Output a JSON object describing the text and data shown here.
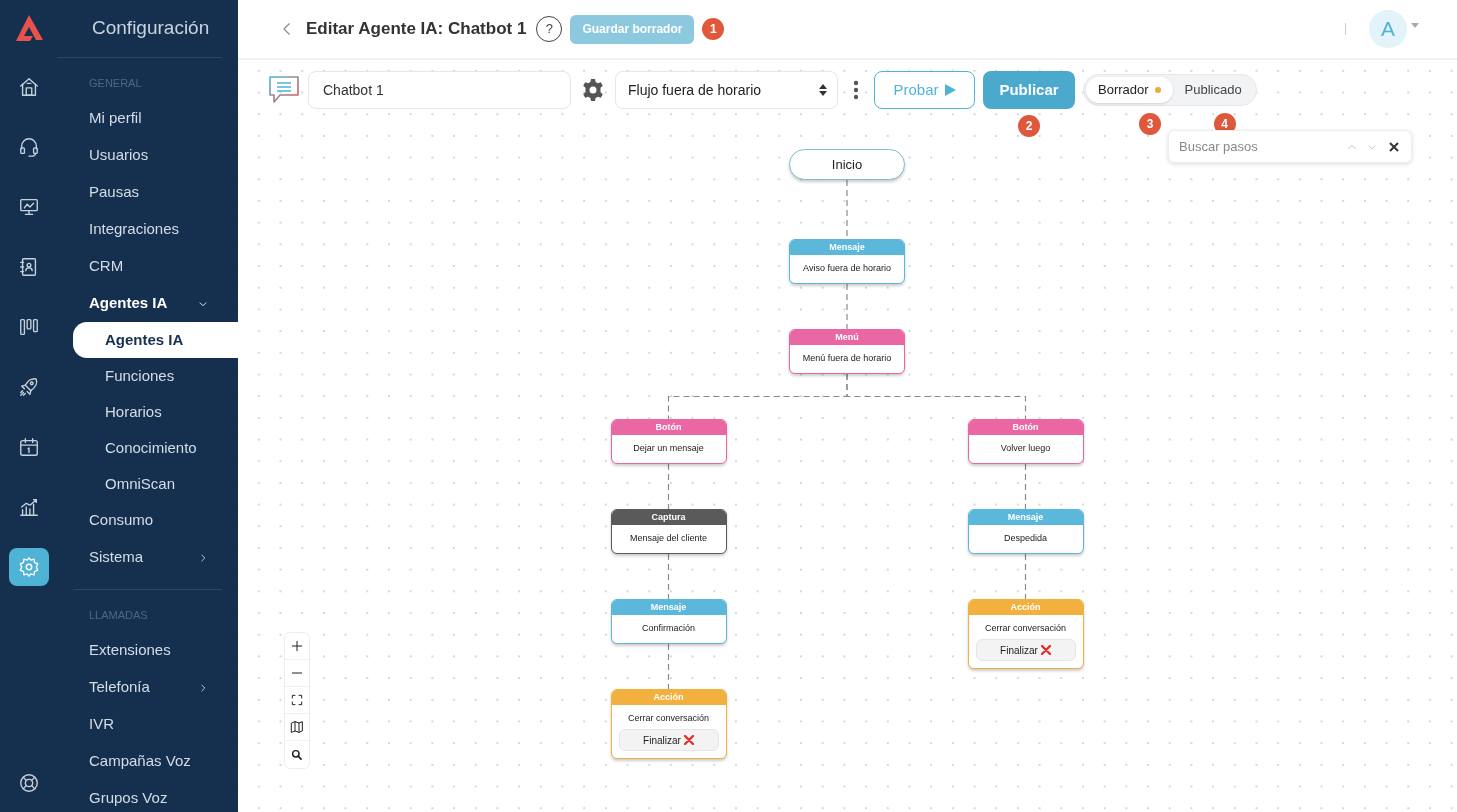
{
  "rail": [
    {
      "selected": false
    },
    {
      "selected": false
    },
    {
      "selected": false
    },
    {
      "selected": false
    },
    {
      "selected": false
    },
    {
      "selected": false
    },
    {
      "selected": false
    },
    {
      "selected": false
    },
    {
      "selected": true
    }
  ],
  "sidebar": {
    "title": "Configuración",
    "sections": [
      {
        "heading": "GENERAL",
        "items": [
          {
            "label": "Mi perfil",
            "selected": false
          },
          {
            "label": "Usuarios",
            "selected": false
          },
          {
            "label": "Pausas",
            "selected": false
          },
          {
            "label": "Integraciones",
            "selected": false
          },
          {
            "label": "CRM",
            "selected": false
          },
          {
            "label": "Agentes IA",
            "selected": false,
            "expanded": true,
            "children": [
              {
                "label": "Agentes IA",
                "selected": true
              },
              {
                "label": "Funciones",
                "selected": false
              },
              {
                "label": "Horarios",
                "selected": false
              },
              {
                "label": "Conocimiento",
                "selected": false
              },
              {
                "label": "OmniScan",
                "selected": false
              }
            ]
          },
          {
            "label": "Consumo",
            "selected": false
          },
          {
            "label": "Sistema",
            "selected": false,
            "expanded": false
          }
        ]
      },
      {
        "heading": "LLAMADAS",
        "items": [
          {
            "label": "Extensiones",
            "selected": false
          },
          {
            "label": "Telefonía",
            "selected": false,
            "expanded": false
          },
          {
            "label": "IVR",
            "selected": false
          },
          {
            "label": "Campañas Voz",
            "selected": false
          },
          {
            "label": "Grupos Voz",
            "selected": false
          }
        ]
      }
    ]
  },
  "header": {
    "title": "Editar Agente IA: Chatbot 1",
    "help": "?",
    "save_button": {
      "label": "Guardar borrador",
      "disabled": true
    },
    "badge": "1",
    "avatar": "A"
  },
  "toolbar": {
    "name_field": "Chatbot 1",
    "flow_select": "Flujo fuera de horario",
    "test_button": "Probar",
    "publish_button": "Publicar",
    "publish_badge": "2",
    "versions": [
      {
        "label": "Borrador",
        "selected": true,
        "unsaved": true,
        "badge": "3"
      },
      {
        "label": "Publicado",
        "selected": false,
        "unsaved": false,
        "badge": "4"
      }
    ]
  },
  "search": {
    "placeholder": "Buscar pasos"
  },
  "flow": {
    "kind": "start",
    "label": "Inicio",
    "children": [
      {
        "kind": "message",
        "type": "Mensaje",
        "label": "Aviso fuera de horario",
        "children": [
          {
            "kind": "menu",
            "type": "Menú",
            "label": "Menú fuera de horario",
            "children": [
              {
                "kind": "button",
                "type": "Botón",
                "label": "Dejar un mensaje",
                "children": [
                  {
                    "kind": "capture",
                    "type": "Captura",
                    "label": "Mensaje del cliente",
                    "children": [
                      {
                        "kind": "message",
                        "type": "Mensaje",
                        "label": "Confirmación",
                        "children": [
                          {
                            "kind": "action",
                            "type": "Acción",
                            "label": "Cerrar conversación",
                            "action": "Finalizar"
                          }
                        ]
                      }
                    ]
                  }
                ]
              },
              {
                "kind": "button",
                "type": "Botón",
                "label": "Volver luego",
                "children": [
                  {
                    "kind": "message",
                    "type": "Mensaje",
                    "label": "Despedida",
                    "children": [
                      {
                        "kind": "action",
                        "type": "Acción",
                        "label": "Cerrar conversación",
                        "action": "Finalizar"
                      }
                    ]
                  }
                ]
              }
            ]
          }
        ]
      }
    ]
  }
}
